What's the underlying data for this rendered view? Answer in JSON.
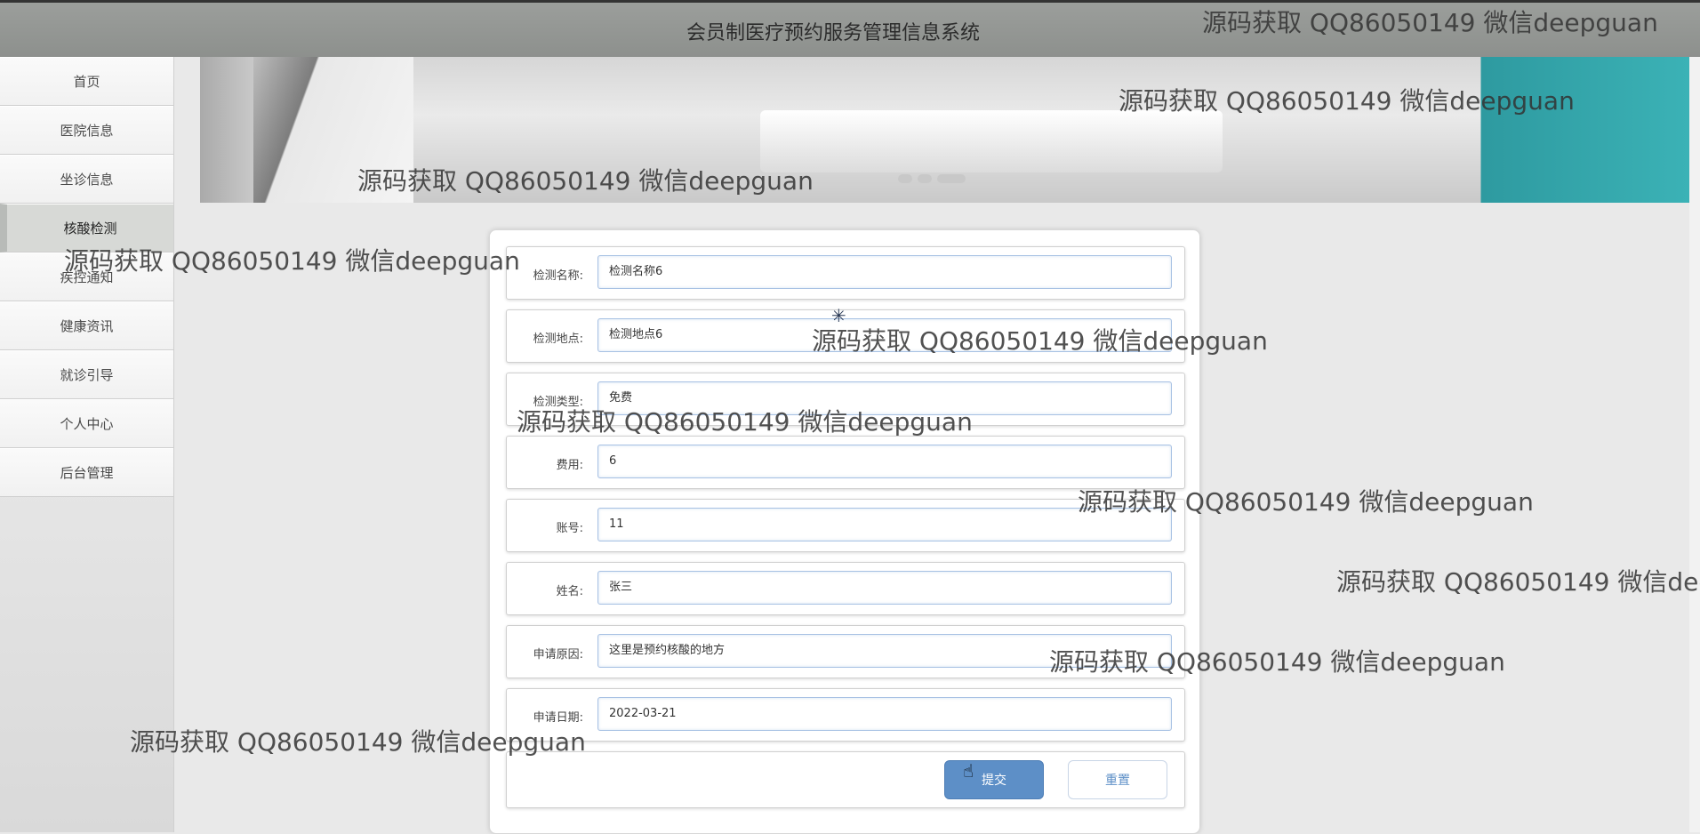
{
  "header": {
    "title": "会员制医疗预约服务管理信息系统"
  },
  "sidebar": {
    "items": [
      {
        "label": "首页"
      },
      {
        "label": "医院信息"
      },
      {
        "label": "坐诊信息"
      },
      {
        "label": "核酸检测"
      },
      {
        "label": "疾控通知"
      },
      {
        "label": "健康资讯"
      },
      {
        "label": "就诊引导"
      },
      {
        "label": "个人中心"
      },
      {
        "label": "后台管理"
      }
    ]
  },
  "form": {
    "fields": [
      {
        "label": "检测名称:",
        "value": "检测名称6"
      },
      {
        "label": "检测地点:",
        "value": "检测地点6"
      },
      {
        "label": "检测类型:",
        "value": "免费"
      },
      {
        "label": "费用:",
        "value": "6"
      },
      {
        "label": "账号:",
        "value": "11"
      },
      {
        "label": "姓名:",
        "value": "张三"
      },
      {
        "label": "申请原因:",
        "value": "这里是预约核酸的地方"
      },
      {
        "label": "申请日期:",
        "value": "2022-03-21"
      }
    ],
    "submit_label": "提交",
    "reset_label": "重置"
  },
  "watermark": "源码获取 QQ86050149 微信deepguan"
}
